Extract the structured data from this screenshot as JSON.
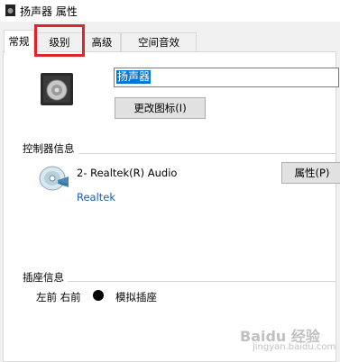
{
  "window": {
    "title": "扬声器 属性",
    "icon": "speaker-icon"
  },
  "tabs": [
    {
      "label": "常规",
      "active": true
    },
    {
      "label": "级别",
      "active": false,
      "highlighted": true
    },
    {
      "label": "高级",
      "active": false
    },
    {
      "label": "空间音效",
      "active": false
    }
  ],
  "highlight_color": "#e0242c",
  "general": {
    "device_name_value": "扬声器",
    "change_icon_button": "更改图标(I)",
    "controller_group_title": "控制器信息",
    "controller_name": "2- Realtek(R) Audio",
    "controller_vendor": "Realtek",
    "properties_button": "属性(P)",
    "jack_group_title": "插座信息",
    "jack_position": "左前 右前",
    "jack_type": "模拟插座",
    "jack_color": "#000000"
  },
  "watermark": {
    "line1": "Baidu 经验",
    "line2": "jingyan.baidu.com"
  }
}
